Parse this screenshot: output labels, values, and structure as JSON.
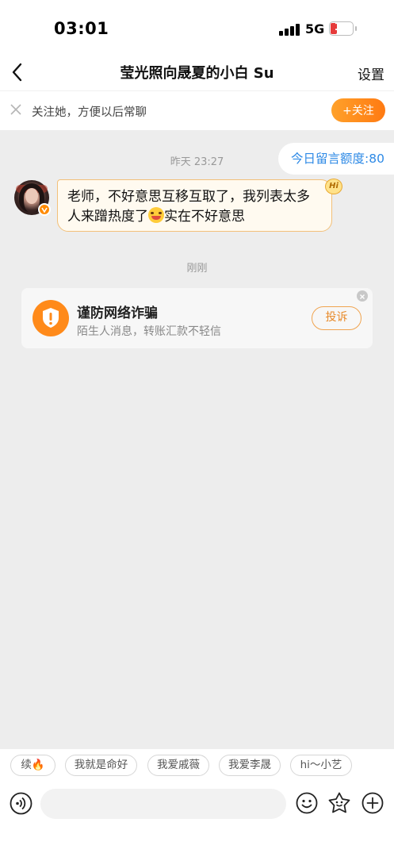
{
  "status_bar": {
    "time": "03:01",
    "network": "5G",
    "battery": "19"
  },
  "nav": {
    "title": "莹光照向晟夏的小白 Su",
    "settings_label": "设置"
  },
  "follow_bar": {
    "text": "关注她，方便以后常聊",
    "follow_label": "+关注"
  },
  "quota_label": "今日留言额度:80",
  "timestamps": [
    "昨天 23:27",
    "刚刚"
  ],
  "message": {
    "line1": "老师，不好意思互移互取了，我列表太多",
    "line2_before": "人来蹭热度了",
    "line2_after": "实在不好意思",
    "hi_badge": "Hi"
  },
  "fraud_card": {
    "title": "谨防网络诈骗",
    "subtitle": "陌生人消息，转账汇款不轻信",
    "report_label": "投诉"
  },
  "quick_replies": [
    "续🔥",
    "我就是命好",
    "我爱戚薇",
    "我爱李晟",
    "hi～小艺"
  ],
  "colors": {
    "accent_orange": "#ff8a00",
    "link_blue": "#2e8ae6",
    "chat_bg": "#ededed"
  },
  "icons": [
    "back-arrow-icon",
    "close-icon",
    "shield-warning-icon",
    "voice-icon",
    "emoji-icon",
    "sticker-icon",
    "plus-icon"
  ]
}
